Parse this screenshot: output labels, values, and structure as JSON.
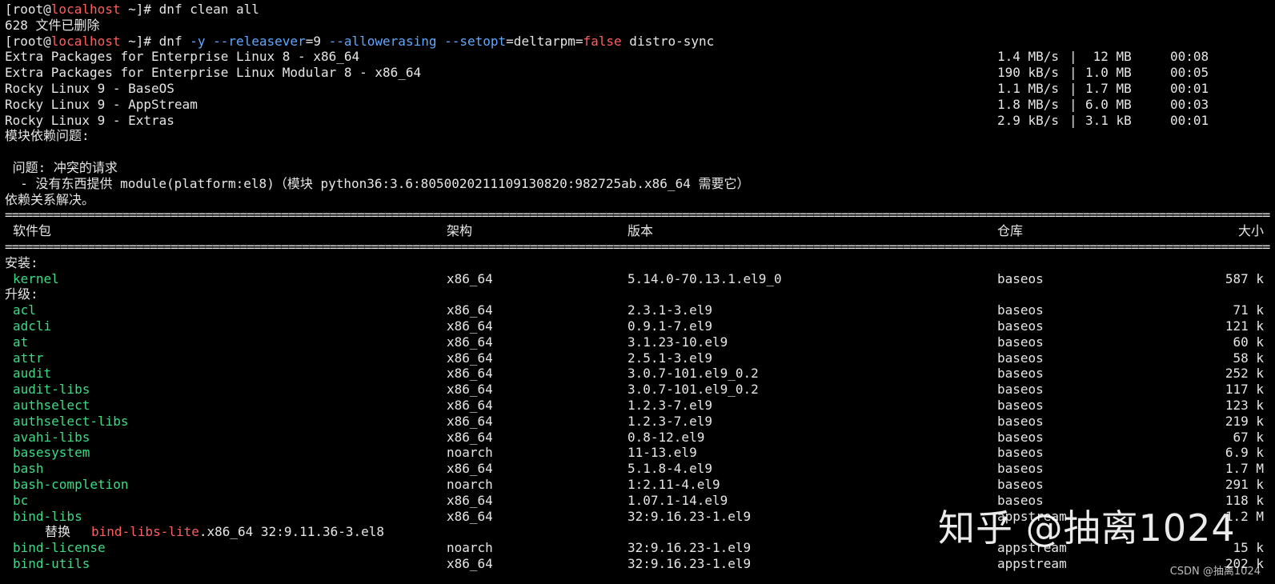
{
  "prompt1": {
    "user": "[root@",
    "host": "localhost",
    "rest": " ~]# ",
    "command": "dnf clean all"
  },
  "clean_result": "628 文件已删除",
  "prompt2": {
    "user": "[root@",
    "host": "localhost",
    "rest": " ~]# ",
    "cmd_start": "dnf ",
    "flag_y": "-y",
    "flag_release": " --releasever",
    "eq1": "=9 ",
    "flag_allowerasing": "--allowerasing",
    "flag_setopt": " --setopt",
    "eq2": "=deltarpm=",
    "val_false": "false",
    "cmd_end": " distro-sync"
  },
  "repos": [
    {
      "name": "Extra Packages for Enterprise Linux 8 - x86_64",
      "speed": "1.4 MB/s",
      "bar": "|",
      "size": " 12 MB",
      "time": "00:08"
    },
    {
      "name": "Extra Packages for Enterprise Linux Modular 8 - x86_64",
      "speed": "190 kB/s",
      "bar": "|",
      "size": "1.0 MB",
      "time": "00:05"
    },
    {
      "name": "Rocky Linux 9 - BaseOS",
      "speed": "1.1 MB/s",
      "bar": "|",
      "size": "1.7 MB",
      "time": "00:01"
    },
    {
      "name": "Rocky Linux 9 - AppStream",
      "speed": "1.8 MB/s",
      "bar": "|",
      "size": "6.0 MB",
      "time": "00:03"
    },
    {
      "name": "Rocky Linux 9 - Extras",
      "speed": "2.9 kB/s",
      "bar": "|",
      "size": "3.1 kB",
      "time": "00:01"
    }
  ],
  "module_problem": "模块依赖问题:",
  "problem_title": " 问题: 冲突的请求",
  "problem_detail": "  - 没有东西提供 module(platform:el8)（模块 python36:3.6:8050020211109130820:982725ab.x86_64 需要它）",
  "resolved": "依赖关系解决。",
  "separator": "================================================================================================================================================================================================================================",
  "headers": {
    "package": "软件包",
    "arch": "架构",
    "version": "版本",
    "repo": "仓库",
    "size": "大小"
  },
  "install_label": "安装:",
  "upgrade_label": "升级:",
  "install_packages": [
    {
      "name": "kernel",
      "arch": "x86_64",
      "version": "5.14.0-70.13.1.el9_0",
      "repo": "baseos",
      "size": "587 k"
    }
  ],
  "upgrade_packages": [
    {
      "name": "acl",
      "arch": "x86_64",
      "version": "2.3.1-3.el9",
      "repo": "baseos",
      "size": "71 k"
    },
    {
      "name": "adcli",
      "arch": "x86_64",
      "version": "0.9.1-7.el9",
      "repo": "baseos",
      "size": "121 k"
    },
    {
      "name": "at",
      "arch": "x86_64",
      "version": "3.1.23-10.el9",
      "repo": "baseos",
      "size": "60 k"
    },
    {
      "name": "attr",
      "arch": "x86_64",
      "version": "2.5.1-3.el9",
      "repo": "baseos",
      "size": "58 k"
    },
    {
      "name": "audit",
      "arch": "x86_64",
      "version": "3.0.7-101.el9_0.2",
      "repo": "baseos",
      "size": "252 k"
    },
    {
      "name": "audit-libs",
      "arch": "x86_64",
      "version": "3.0.7-101.el9_0.2",
      "repo": "baseos",
      "size": "117 k"
    },
    {
      "name": "authselect",
      "arch": "x86_64",
      "version": "1.2.3-7.el9",
      "repo": "baseos",
      "size": "123 k"
    },
    {
      "name": "authselect-libs",
      "arch": "x86_64",
      "version": "1.2.3-7.el9",
      "repo": "baseos",
      "size": "219 k"
    },
    {
      "name": "avahi-libs",
      "arch": "x86_64",
      "version": "0.8-12.el9",
      "repo": "baseos",
      "size": "67 k"
    },
    {
      "name": "basesystem",
      "arch": "noarch",
      "version": "11-13.el9",
      "repo": "baseos",
      "size": "6.9 k"
    },
    {
      "name": "bash",
      "arch": "x86_64",
      "version": "5.1.8-4.el9",
      "repo": "baseos",
      "size": "1.7 M"
    },
    {
      "name": "bash-completion",
      "arch": "noarch",
      "version": "1:2.11-4.el9",
      "repo": "baseos",
      "size": "291 k"
    },
    {
      "name": "bc",
      "arch": "x86_64",
      "version": "1.07.1-14.el9",
      "repo": "baseos",
      "size": "118 k"
    },
    {
      "name": "bind-libs",
      "arch": "x86_64",
      "version": "32:9.16.23-1.el9",
      "repo": "appstream",
      "size": "1.2 M"
    }
  ],
  "obsolete": {
    "label": "替换",
    "pkg": "bind-libs-lite",
    "rest": ".x86_64 32:9.11.36-3.el8"
  },
  "upgrade_packages_2": [
    {
      "name": "bind-license",
      "arch": "noarch",
      "version": "32:9.16.23-1.el9",
      "repo": "appstream",
      "size": "15 k"
    },
    {
      "name": "bind-utils",
      "arch": "x86_64",
      "version": "32:9.16.23-1.el9",
      "repo": "appstream",
      "size": "202 k"
    }
  ],
  "watermark": "知乎 @抽离1024",
  "watermark_small": "CSDN @抽离1024",
  "colors": {
    "background": "#000000",
    "text": "#e6e6e6",
    "host": "#ff5f5f",
    "option": "#5fa8ff",
    "package": "#3ddc84"
  }
}
